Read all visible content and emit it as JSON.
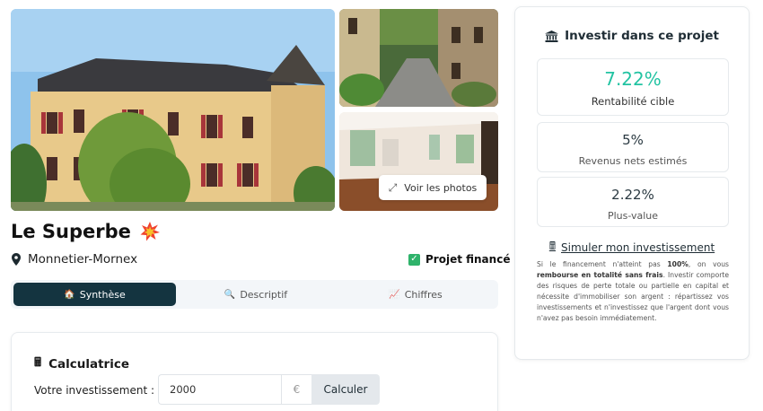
{
  "gallery": {
    "see_photos_label": "Voir les photos"
  },
  "project": {
    "title": "Le Superbe",
    "location": "Monnetier-Mornex",
    "financed_label": "Projet financé"
  },
  "tabs": [
    {
      "label": "Synthèse",
      "icon": "house-icon",
      "active": true
    },
    {
      "label": "Descriptif",
      "icon": "magnifier-icon",
      "active": false
    },
    {
      "label": "Chiffres",
      "icon": "chart-icon",
      "active": false
    }
  ],
  "calculator": {
    "title": "Calculatrice",
    "label": "Votre investissement :",
    "value": "2000",
    "unit": "€",
    "button_label": "Calculer"
  },
  "invest": {
    "title": "Investir dans ce projet",
    "stats": [
      {
        "value": "7.22%",
        "label": "Rentabilité cible"
      },
      {
        "value": "5%",
        "label": "Revenus nets estimés"
      },
      {
        "value": "2.22%",
        "label": "Plus-value"
      }
    ],
    "simulate_label": "Simuler mon investissement",
    "disclaimer": {
      "p1": "Si le financement n'atteint pas",
      "b1": "100%",
      "p2": ", on vous",
      "b2": "rembourse en totalité sans frais",
      "p3": ". Investir comporte des risques de perte totale ou partielle en capital et nécessite d'immobiliser son argent : répartissez vos investissements et n'investissez que l'argent dont vous n'avez pas besoin immédiatement."
    }
  },
  "colors": {
    "accent": "#22c3a2",
    "active_tab": "#143440",
    "financed": "#2fb36b"
  }
}
